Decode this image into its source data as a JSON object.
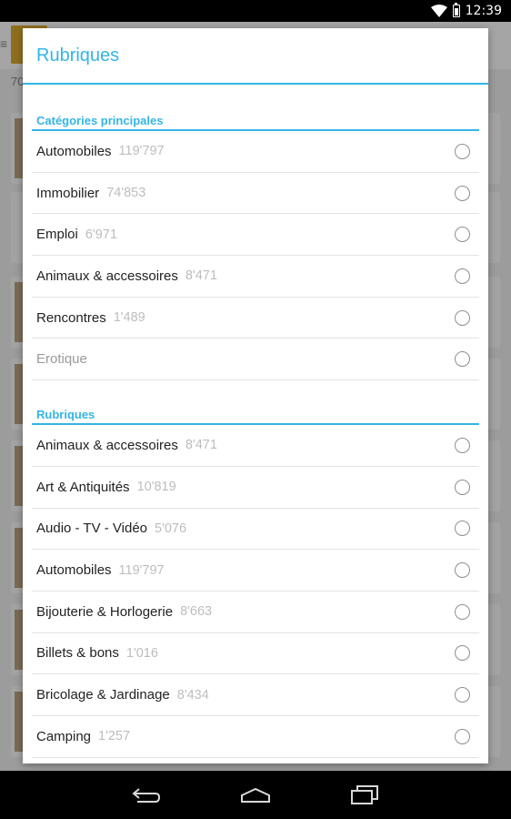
{
  "status_bar": {
    "time": "12:39"
  },
  "background": {
    "count_fragment": "70"
  },
  "dialog": {
    "title": "Rubriques",
    "main_section": {
      "title": "Catégories principales",
      "items": [
        {
          "label": "Automobiles",
          "count": "119'797"
        },
        {
          "label": "Immobilier",
          "count": "74'853"
        },
        {
          "label": "Emploi",
          "count": "6'971"
        },
        {
          "label": "Animaux & accessoires",
          "count": "8'471"
        },
        {
          "label": "Rencontres",
          "count": "1'489"
        },
        {
          "label": "Erotique",
          "count": ""
        }
      ]
    },
    "rubriques_section": {
      "title": "Rubriques",
      "items": [
        {
          "label": "Animaux & accessoires",
          "count": "8'471"
        },
        {
          "label": "Art & Antiquités",
          "count": "10'819"
        },
        {
          "label": "Audio - TV - Vidéo",
          "count": "5'076"
        },
        {
          "label": "Automobiles",
          "count": "119'797"
        },
        {
          "label": "Bijouterie & Horlogerie",
          "count": "8'663"
        },
        {
          "label": "Billets & bons",
          "count": "1'016"
        },
        {
          "label": "Bricolage & Jardinage",
          "count": "8'434"
        },
        {
          "label": "Camping",
          "count": "1'257"
        }
      ]
    }
  },
  "nav_bar": {
    "icons": [
      "back-icon",
      "home-icon",
      "recent-apps-icon"
    ]
  }
}
